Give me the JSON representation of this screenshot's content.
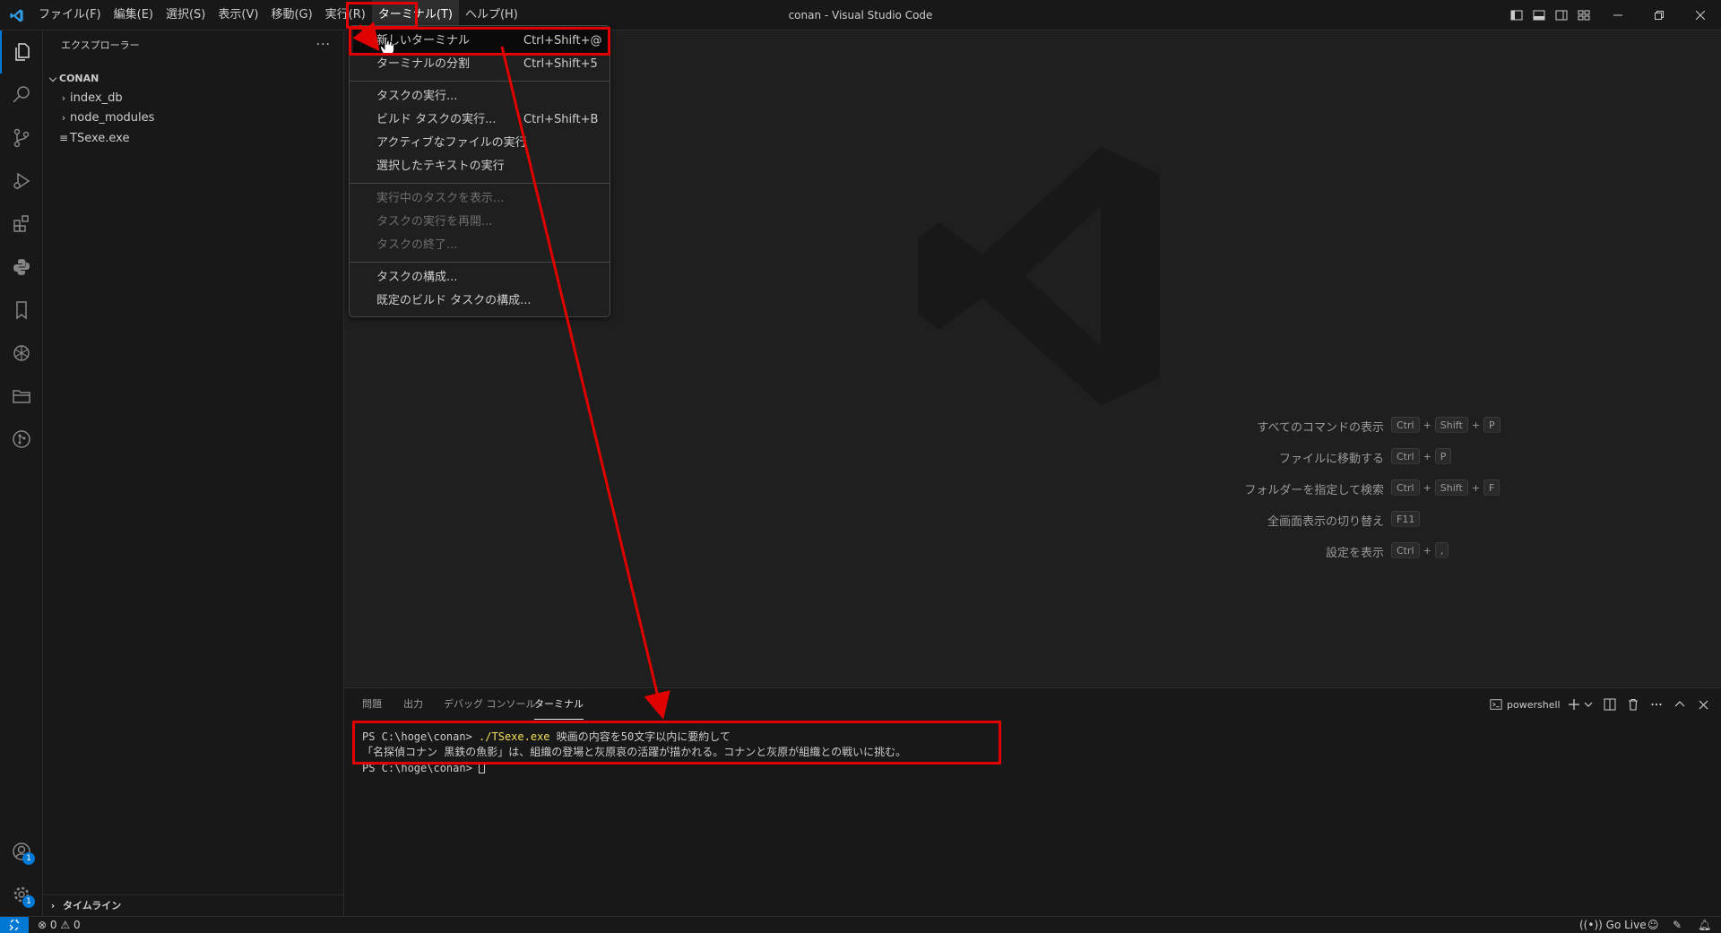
{
  "window": {
    "title": "conan - Visual Studio Code"
  },
  "menubar": {
    "items": [
      {
        "label": "ファイル(F)"
      },
      {
        "label": "編集(E)"
      },
      {
        "label": "選択(S)"
      },
      {
        "label": "表示(V)"
      },
      {
        "label": "移動(G)"
      },
      {
        "label": "実行(R)"
      },
      {
        "label": "ターミナル(T)"
      },
      {
        "label": "ヘルプ(H)"
      }
    ]
  },
  "terminal_menu": {
    "items": [
      {
        "label": "新しいターミナル",
        "shortcut": "Ctrl+Shift+@"
      },
      {
        "label": "ターミナルの分割",
        "shortcut": "Ctrl+Shift+5"
      },
      {
        "label": "タスクの実行...",
        "shortcut": ""
      },
      {
        "label": "ビルド タスクの実行...",
        "shortcut": "Ctrl+Shift+B"
      },
      {
        "label": "アクティブなファイルの実行",
        "shortcut": ""
      },
      {
        "label": "選択したテキストの実行",
        "shortcut": ""
      },
      {
        "label": "実行中のタスクを表示...",
        "shortcut": ""
      },
      {
        "label": "タスクの実行を再開...",
        "shortcut": ""
      },
      {
        "label": "タスクの終了...",
        "shortcut": ""
      },
      {
        "label": "タスクの構成...",
        "shortcut": ""
      },
      {
        "label": "既定のビルド タスクの構成...",
        "shortcut": ""
      }
    ]
  },
  "sidebar": {
    "title": "エクスプローラー",
    "more": "···",
    "folder": "CONAN",
    "items": [
      {
        "label": "index_db"
      },
      {
        "label": "node_modules"
      },
      {
        "label": "TSexe.exe"
      }
    ],
    "timeline": "タイムライン"
  },
  "activitybar": {
    "accounts_badge": "1",
    "manage_badge": "1"
  },
  "welcome": {
    "shortcuts": [
      {
        "label": "すべてのコマンドの表示",
        "keys": [
          "Ctrl",
          "Shift",
          "P"
        ]
      },
      {
        "label": "ファイルに移動する",
        "keys": [
          "Ctrl",
          "P"
        ]
      },
      {
        "label": "フォルダーを指定して検索",
        "keys": [
          "Ctrl",
          "Shift",
          "F"
        ]
      },
      {
        "label": "全画面表示の切り替え",
        "keys": [
          "F11"
        ]
      },
      {
        "label": "設定を表示",
        "keys": [
          "Ctrl",
          ","
        ]
      }
    ],
    "plus": "+"
  },
  "panel": {
    "tabs": [
      {
        "label": "問題"
      },
      {
        "label": "出力"
      },
      {
        "label": "デバッグ コンソール"
      },
      {
        "label": "ターミナル"
      }
    ],
    "shell": "powershell",
    "terminal": {
      "prompt": "PS C:\\hoge\\conan> ",
      "command": "./TSexe.exe",
      "args": " 映画の内容を50文字以内に要約して",
      "output": "「名探偵コナン 黒鉄の魚影」は、組織の登場と灰原哀の活躍が描かれる。コナンと灰原が組織との戦いに挑む。",
      "prompt2": "PS C:\\hoge\\conan> "
    }
  },
  "statusbar": {
    "errors": "0",
    "warnings": "0",
    "golive": "Go Live"
  },
  "colors": {
    "accent": "#0078d4",
    "annotation": "#e00000",
    "command": "#f1e05a"
  }
}
